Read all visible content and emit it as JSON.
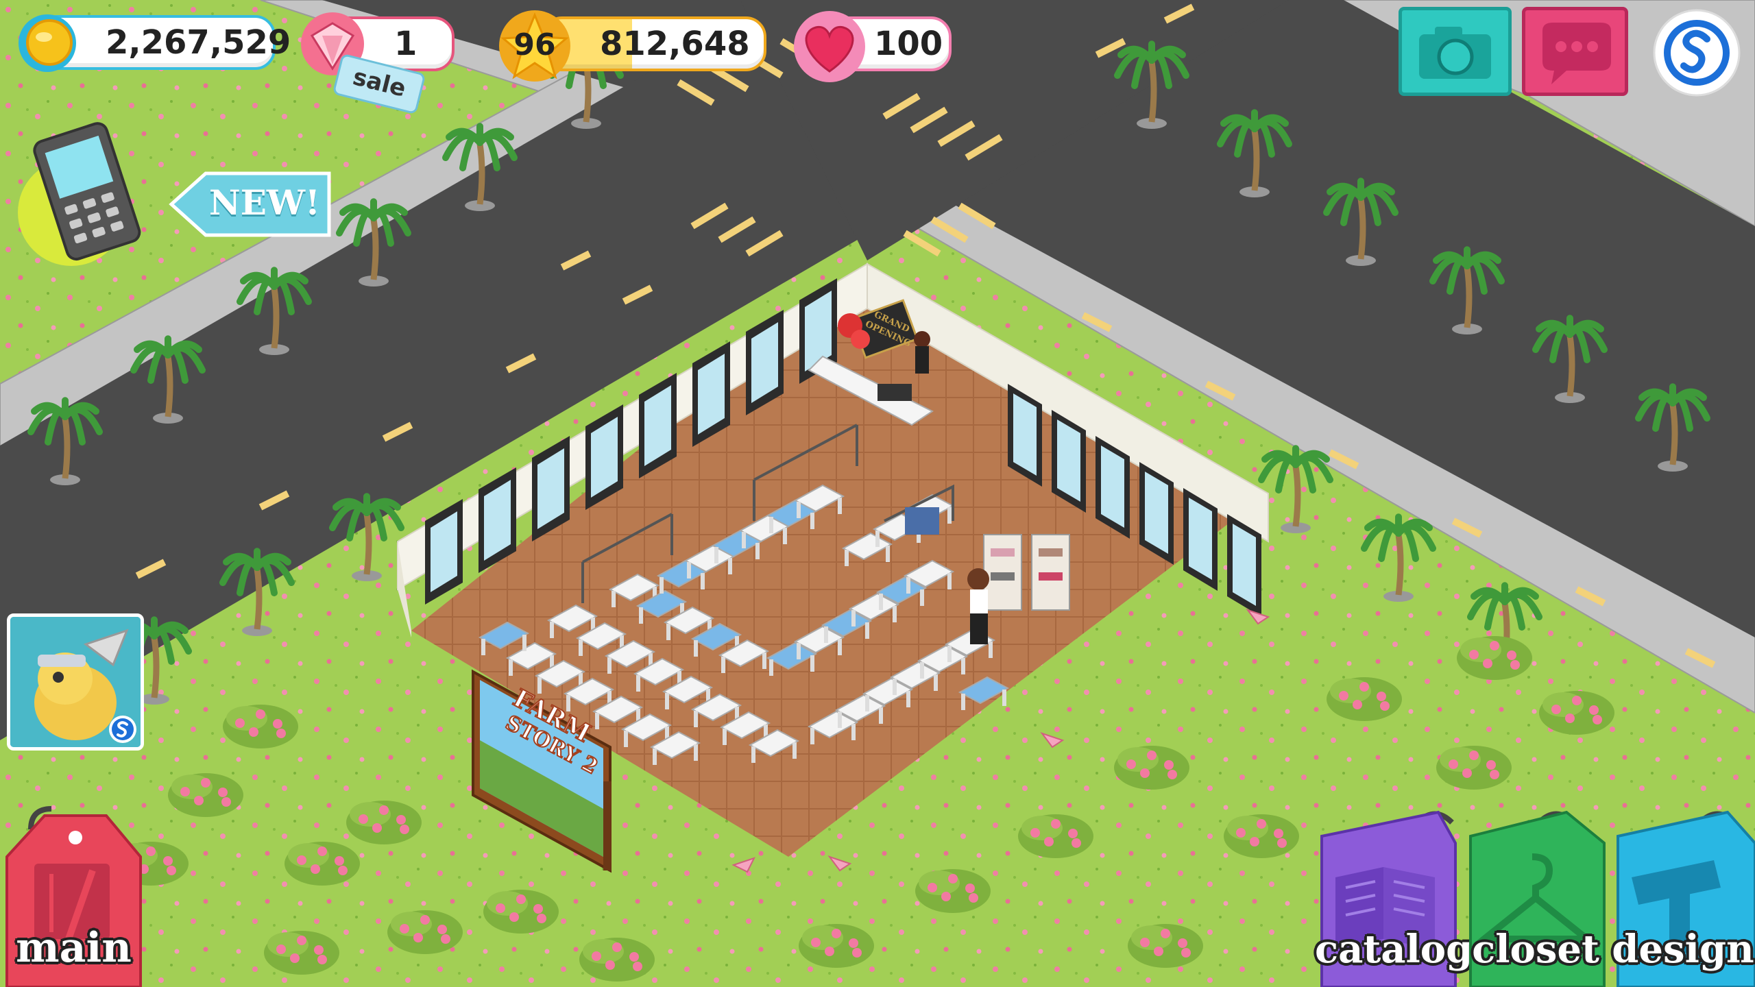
{
  "hud": {
    "coins": "2,267,529",
    "gems": "1",
    "sale_label": "sale",
    "level": "96",
    "experience": "812,648",
    "hearts": "100"
  },
  "new_badge": "NEW!",
  "billboard": {
    "title_line1": "FARM",
    "title_line2": "STORY 2"
  },
  "shop": {
    "grand_opening_line1": "GRAND",
    "grand_opening_line2": "OPENING"
  },
  "nav": {
    "main": "main",
    "catalog": "catalog",
    "closet": "closet",
    "design": "design"
  },
  "icons": [
    "coin-icon",
    "gem-icon",
    "sale-tag-icon",
    "level-star-icon",
    "heart-icon",
    "camera-icon",
    "chat-icon",
    "storm8-icon",
    "phone-icon",
    "notebook-icon",
    "book-icon",
    "hanger-icon",
    "hammer-icon"
  ],
  "colors": {
    "grass": "#9ccb4e",
    "road": "#4a4a4a",
    "sidewalk": "#bfbfbf",
    "floor": "#b97a50",
    "main_tag": "#e8465a",
    "catalog_tag": "#8c5bd9",
    "closet_tag": "#2fb45a",
    "design_tag": "#29b7e3",
    "camera_button": "#2fc9c0",
    "chat_button": "#e8467a"
  }
}
